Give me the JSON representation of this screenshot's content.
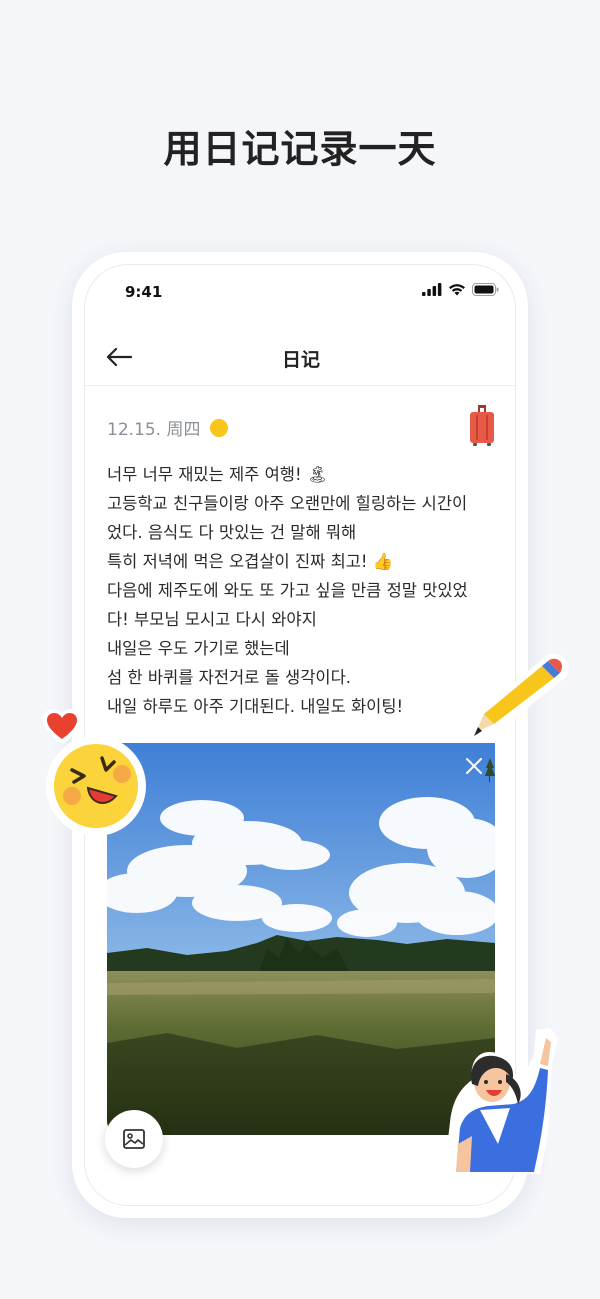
{
  "headline": "用日记记录一天",
  "status_bar": {
    "time": "9:41",
    "icons": [
      "signal-icon",
      "wifi-icon",
      "battery-icon"
    ]
  },
  "nav": {
    "back_icon": "arrow-left-icon",
    "title": "日记"
  },
  "entry": {
    "date": "12.15. 周四",
    "mood_color": "#f8c51b",
    "tag_icon": "suitcase-icon",
    "lines": [
      "너무 너무 재밌는 제주 여행! 🏝",
      "고등학교 친구들이랑 아주 오랜만에 힐링하는 시간이",
      "었다. 음식도 다 맛있는 건 말해 뭐해",
      "특히 저녁에 먹은 오겹살이 진짜 최고! 👍",
      "다음에 제주도에 와도 또 가고 싶을 만큼 정말 맛있었",
      "다! 부모님 모시고 다시 와야지",
      "내일은 우도 가기로 했는데",
      "섬 한 바퀴를 자전거로 돌 생각이다.",
      "내일 하루도 아주 기대된다. 내일도 화이팅!"
    ],
    "photo_description_icon": "landscape-photo",
    "photo_close_icon": "close-icon",
    "gallery_icon": "image-icon"
  },
  "stickers": [
    "heart-sticker",
    "laughing-face-sticker",
    "pencil-sticker",
    "cheering-woman-sticker"
  ]
}
